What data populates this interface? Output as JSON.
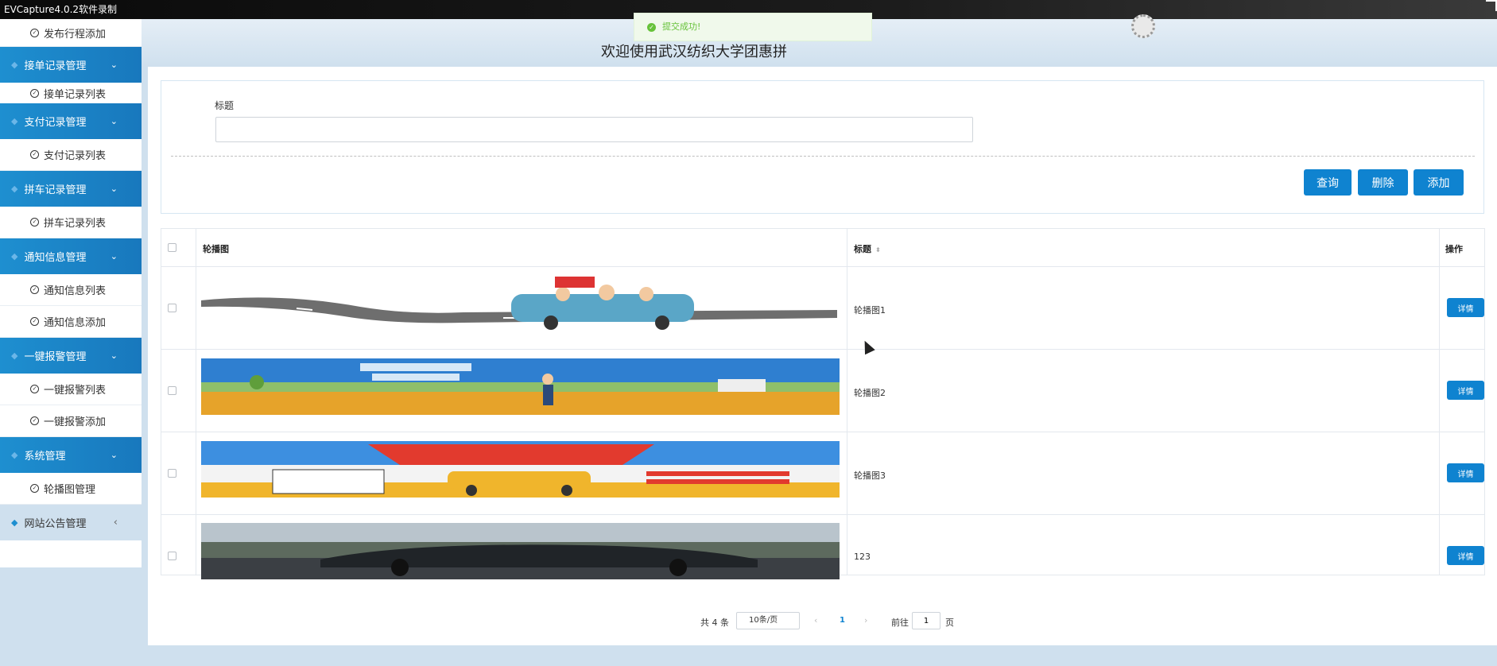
{
  "recorder": {
    "title": "EVCapture4.0.2软件录制"
  },
  "header": {
    "welcome": "欢迎使用武汉纺织大学团惠拼"
  },
  "toast": {
    "message": "提交成功!"
  },
  "sidebar": {
    "items": [
      {
        "type": "item",
        "label": "发布行程添加"
      },
      {
        "type": "group",
        "label": "接单记录管理"
      },
      {
        "type": "item",
        "label": "接单记录列表"
      },
      {
        "type": "group",
        "label": "支付记录管理"
      },
      {
        "type": "item",
        "label": "支付记录列表"
      },
      {
        "type": "group",
        "label": "拼车记录管理"
      },
      {
        "type": "item",
        "label": "拼车记录列表"
      },
      {
        "type": "group",
        "label": "通知信息管理"
      },
      {
        "type": "item",
        "label": "通知信息列表"
      },
      {
        "type": "item",
        "label": "通知信息添加"
      },
      {
        "type": "group",
        "label": "一键报警管理"
      },
      {
        "type": "item",
        "label": "一键报警列表"
      },
      {
        "type": "item",
        "label": "一键报警添加"
      },
      {
        "type": "group",
        "label": "系统管理"
      },
      {
        "type": "item",
        "label": "轮播图管理"
      },
      {
        "type": "plain",
        "label": "网站公告管理"
      }
    ]
  },
  "search": {
    "label": "标题",
    "value": "",
    "buttons": {
      "search": "查询",
      "delete": "删除",
      "add": "添加"
    }
  },
  "table": {
    "headers": {
      "image": "轮播图",
      "title": "标题",
      "actions": "操作"
    },
    "rows": [
      {
        "title": "轮播图1",
        "action": "详情",
        "image_icon": "carpool-cartoon-banner"
      },
      {
        "title": "轮播图2",
        "action": "详情",
        "image_icon": "carpool-landscape-banner"
      },
      {
        "title": "轮播图3",
        "action": "详情",
        "image_icon": "carpool-qr-banner"
      },
      {
        "title": "123",
        "action": "详情",
        "image_icon": "car-photo-banner"
      }
    ]
  },
  "pagination": {
    "total": "共 4 条",
    "page_size": "10条/页",
    "current_page": "1",
    "goto_label": "前往",
    "goto_value": "1",
    "page_suffix": "页"
  },
  "colors": {
    "primary": "#0f83d0",
    "sidebar_group": "#1e8fd0",
    "background": "#cfe0ee",
    "toast_green": "#67c23a"
  }
}
